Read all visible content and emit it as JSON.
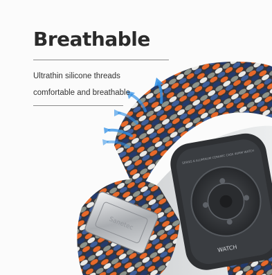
{
  "headline": "Breathable",
  "feature_lines": [
    "Ultrathin silicone threads",
    "comfortable and breathable"
  ],
  "buckle_engraving": "Sanetec",
  "watch_case_text": "SERIES 6  ALUMINUM CERAMIC CASE  40MM  WATCH",
  "watch_logo": "WATCH",
  "colors": {
    "accent_arrow": "#2f8fe6",
    "band_orange": "#e8692a",
    "band_navy": "#243a6b",
    "band_gray": "#8d948c",
    "band_white": "#e9e9e6",
    "watch_body": "#2e3033"
  }
}
